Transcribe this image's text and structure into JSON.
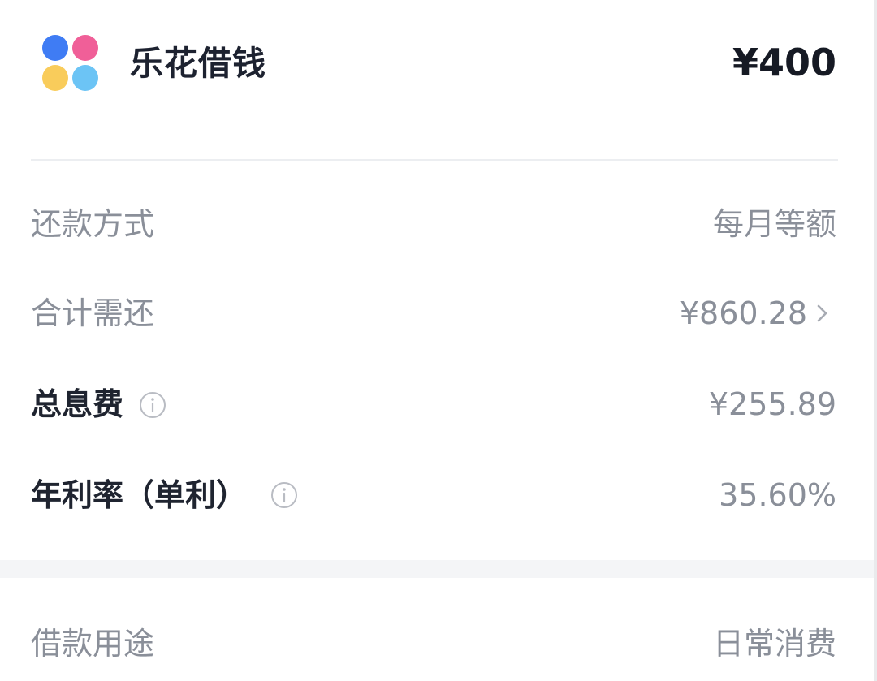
{
  "header": {
    "brand_name": "乐花借钱",
    "amount": "¥400"
  },
  "details": {
    "repayment_method": {
      "label": "还款方式",
      "value": "每月等额"
    },
    "total_repayment": {
      "label": "合计需还",
      "value": "¥860.28"
    },
    "total_interest": {
      "label": "总息费",
      "value": "¥255.89"
    },
    "annual_rate": {
      "label": "年利率（单利）",
      "value": "35.60%"
    }
  },
  "purpose": {
    "label": "借款用途",
    "value": "日常消费"
  },
  "colors": {
    "logo_blue": "#3f7cf4",
    "logo_pink": "#f05f98",
    "logo_yellow": "#f9cc5b",
    "logo_cyan": "#6cc4f5",
    "primary_text": "#1f2430",
    "secondary_text": "#8a8f99"
  },
  "icons": {
    "logo": "four-petal-logo-icon",
    "info": "info-circle-icon",
    "chevron": "chevron-right-icon"
  }
}
